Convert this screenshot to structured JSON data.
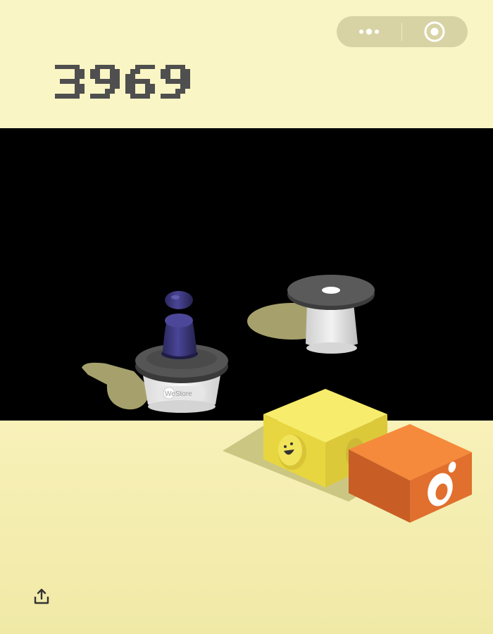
{
  "game": {
    "score": "3969",
    "pixel_font": {
      "3": [
        [
          1,
          1,
          1,
          1,
          1,
          0
        ],
        [
          0,
          0,
          0,
          0,
          1,
          1
        ],
        [
          0,
          0,
          0,
          0,
          1,
          1
        ],
        [
          0,
          1,
          1,
          1,
          1,
          0
        ],
        [
          0,
          0,
          0,
          0,
          1,
          1
        ],
        [
          0,
          0,
          0,
          0,
          1,
          1
        ],
        [
          1,
          1,
          1,
          1,
          1,
          0
        ]
      ],
      "9": [
        [
          0,
          1,
          1,
          1,
          1,
          0
        ],
        [
          1,
          1,
          0,
          0,
          1,
          1
        ],
        [
          1,
          1,
          0,
          0,
          1,
          1
        ],
        [
          0,
          1,
          1,
          1,
          1,
          1
        ],
        [
          0,
          0,
          0,
          0,
          1,
          1
        ],
        [
          0,
          0,
          0,
          1,
          1,
          0
        ],
        [
          1,
          1,
          1,
          1,
          0,
          0
        ]
      ],
      "6": [
        [
          0,
          0,
          1,
          1,
          1,
          1
        ],
        [
          0,
          1,
          1,
          0,
          0,
          0
        ],
        [
          1,
          1,
          0,
          0,
          0,
          0
        ],
        [
          1,
          1,
          1,
          1,
          1,
          0
        ],
        [
          1,
          1,
          0,
          0,
          1,
          1
        ],
        [
          1,
          1,
          0,
          0,
          1,
          1
        ],
        [
          0,
          1,
          1,
          1,
          1,
          0
        ]
      ]
    },
    "cup_label": "WeStore"
  },
  "menu_capsule": {
    "more_icon": "more-dots-icon",
    "close_icon": "target-circle-icon"
  },
  "share": {
    "icon": "share-upload-icon"
  },
  "colors": {
    "background": "#f9f4c2",
    "score_text": "#4f4f4f",
    "void": "#000000",
    "yellow_box": "#f0e04a",
    "orange_box": "#ee7c35",
    "jumper": "#3d3a7e"
  }
}
